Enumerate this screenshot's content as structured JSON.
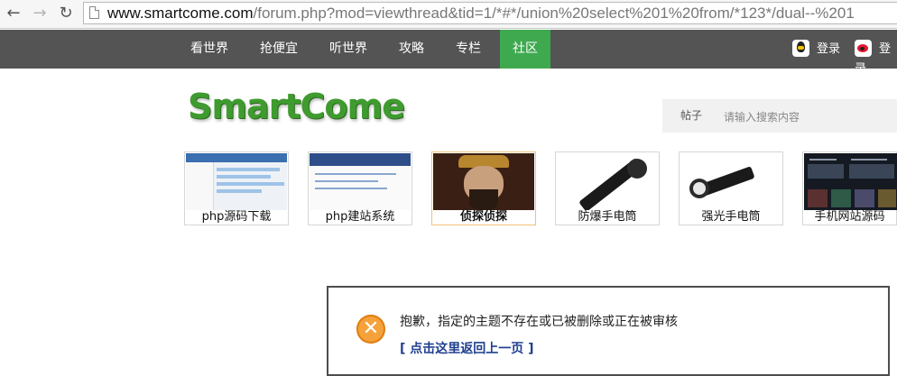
{
  "browser": {
    "url_host": "www.smartcome.com",
    "url_rest": "/forum.php?mod=viewthread&tid=1/*#*/union%20select%201%20from/*123*/dual--%201"
  },
  "nav": {
    "items": [
      "看世界",
      "抢便宜",
      "听世界",
      "攻略",
      "专栏",
      "社区"
    ],
    "active": "社区",
    "login_qq": "登录",
    "login_weibo": "登录"
  },
  "header": {
    "logo": "SmartCome",
    "search_type": "帖子",
    "search_placeholder": "请输入搜索内容"
  },
  "ads": [
    {
      "label": "php源码下载"
    },
    {
      "label": "php建站系统"
    },
    {
      "label": "侦探侦探"
    },
    {
      "label": "防爆手电筒"
    },
    {
      "label": "强光手电筒"
    },
    {
      "label": "手机网站源码"
    }
  ],
  "error": {
    "message": "抱歉，指定的主题不存在或已被删除或正在被审核",
    "back_link": "[ 点击这里返回上一页 ]",
    "icon": "close-icon"
  },
  "colors": {
    "nav_bg": "#545454",
    "nav_active": "#3fa94f",
    "logo": "#3f9b2f",
    "error_icon": "#f5a23b",
    "link": "#1f3f8f"
  }
}
